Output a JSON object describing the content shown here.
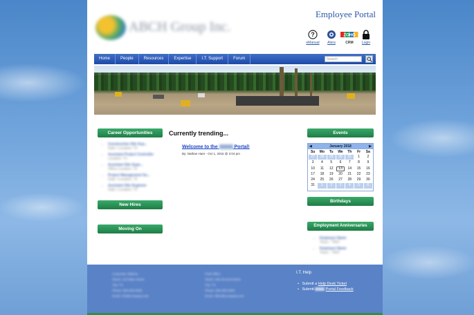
{
  "header": {
    "portal_title": "Employee Portal",
    "company_logo_text": "ABCH Group Inc.",
    "quick_links": [
      {
        "label": "eManual",
        "icon": "help-icon"
      },
      {
        "label": "Alera",
        "icon": "alera-icon"
      },
      {
        "label": "CRM",
        "icon": "zoho-crm-icon",
        "logo_text": "ZOHO"
      },
      {
        "label": "Login",
        "icon": "lock-icon"
      }
    ]
  },
  "nav": {
    "items": [
      "Home",
      "People",
      "Resources",
      "Expertise",
      "I.T. Support",
      "Forum"
    ],
    "search_placeholder": "Search"
  },
  "left": {
    "career_title": "Career Opportunities",
    "career_items": [
      {
        "title": "Construction Site Sup...",
        "meta": "Date / Location: TX"
      },
      {
        "title": "Assistant Project Controller",
        "meta": "Location: TX"
      },
      {
        "title": "Assistant Site Supe...",
        "meta": "Office Location: TX"
      },
      {
        "title": "Project Management Su...",
        "meta": "Date / Location: TX"
      },
      {
        "title": "Assistant Site Engineer",
        "meta": "Date / Location: TX"
      }
    ],
    "new_hires_title": "New Hires",
    "moving_on_title": "Moving On"
  },
  "center": {
    "trending_title": "Currently trending...",
    "post_link_before": "Welcome to the",
    "post_link_after": "Portal!",
    "post_meta": "By: Nathan Hare - Oct 1, 2015 @ 2:04 pm"
  },
  "right": {
    "events_title": "Events",
    "calendar": {
      "month_label": "January 2018",
      "prev": "◀",
      "next": "▶",
      "days_of_week": [
        "Su",
        "Mo",
        "Tu",
        "We",
        "Th",
        "Fr",
        "Sa"
      ],
      "weeks": [
        [
          "27",
          "28",
          "29",
          "30",
          "31",
          "1",
          "2"
        ],
        [
          "3",
          "4",
          "5",
          "6",
          "7",
          "8",
          "9"
        ],
        [
          "10",
          "11",
          "12",
          "13",
          "14",
          "15",
          "16"
        ],
        [
          "17",
          "18",
          "19",
          "20",
          "21",
          "22",
          "23"
        ],
        [
          "24",
          "25",
          "26",
          "27",
          "28",
          "29",
          "30"
        ],
        [
          "31",
          "1",
          "2",
          "3",
          "4",
          "5",
          "6"
        ]
      ],
      "today": "13"
    },
    "birthdays_title": "Birthdays",
    "anniversaries_title": "Employment Anniversaries",
    "anniversary_items": [
      {
        "name": "Employee Name",
        "meta": "Years - TWO"
      },
      {
        "name": "Employee Name",
        "meta": "Years - TWO"
      }
    ]
  },
  "footer": {
    "contacts": [
      {
        "lines": [
          "Corporate Address",
          "Street: 123 Main Street",
          "City: TX",
          "Phone: 555-555-5555",
          "Email: info@company.com"
        ]
      },
      {
        "lines": [
          "Field Office",
          "Street: 456 Second Street",
          "City: TX",
          "Phone: 555-555-5555",
          "Email: office@company.com"
        ]
      }
    ],
    "it_help_title": "I.T. Help",
    "it_items": [
      {
        "prefix": "Submit a",
        "link": "Help Desk Ticket"
      },
      {
        "prefix": "Submit",
        "link": "Portal Feedback"
      }
    ]
  },
  "colors": {
    "nav_blue": "#1f4aa8",
    "section_green": "#1e7d45",
    "link_blue": "#1f47c8",
    "footer_blue": "#5a82c7"
  }
}
